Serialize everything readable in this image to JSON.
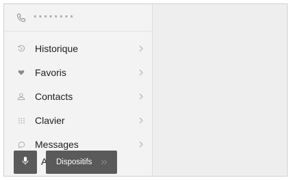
{
  "phone": {
    "number": "********",
    "icon": "phone-icon"
  },
  "menu": {
    "items": [
      {
        "label": "Historique",
        "icon": "history-icon"
      },
      {
        "label": "Favoris",
        "icon": "heart-icon"
      },
      {
        "label": "Contacts",
        "icon": "person-icon"
      },
      {
        "label": "Clavier",
        "icon": "keypad-icon"
      },
      {
        "label": "Messages",
        "icon": "message-icon"
      }
    ],
    "partial_item_label": "Act"
  },
  "bottom_bar": {
    "voice_icon": "microphone-icon",
    "devices_label": "Dispositifs",
    "devices_icon": "double-chevron-right-icon"
  },
  "colors": {
    "background": "#f3f3f3",
    "button": "#5a5a5a",
    "icon": "#9a9a9a",
    "text": "#1e1e1e"
  }
}
